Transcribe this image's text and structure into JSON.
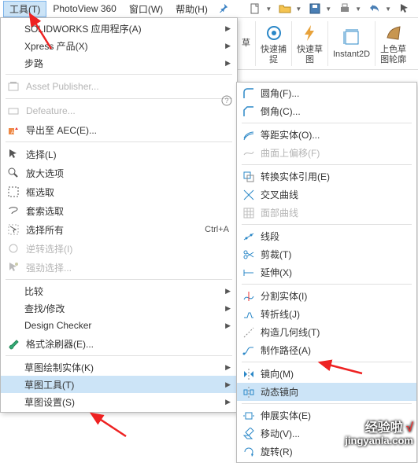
{
  "menubar": {
    "tools": "工具(T)",
    "photoview": "PhotoView 360",
    "window": "窗口(W)",
    "help": "帮助(H)"
  },
  "ribbon": {
    "grp0": "草",
    "grp1_l1": "快速捕",
    "grp1_l2": "捉",
    "grp2_l1": "快速草",
    "grp2_l2": "图",
    "grp3": "Instant2D",
    "grp4_l1": "上色草",
    "grp4_l2": "图轮廓"
  },
  "dd": {
    "sub_sw": "SOLIDWORKS 应用程序(A)",
    "sub_xpress": "Xpress 产品(X)",
    "sub_bulu": "步路",
    "asset": "Asset Publisher...",
    "defeature": "Defeature...",
    "export_aec": "导出至 AEC(E)...",
    "select": "选择(L)",
    "magnify": "放大选项",
    "boxsel": "框选取",
    "lasso": "套索选取",
    "selall": "选择所有",
    "selall_sc": "Ctrl+A",
    "invsel": "逆转选择(I)",
    "powersel": "强劲选择...",
    "compare": "比较",
    "findmod": "查找/修改",
    "design_checker": "Design Checker",
    "fmt_painter": "格式涂刷器(E)...",
    "sketch_entities": "草图绘制实体(K)",
    "sketch_tools": "草图工具(T)",
    "sketch_settings": "草图设置(S)"
  },
  "sm": {
    "fillet": "圆角(F)...",
    "chamfer": "倒角(C)...",
    "offset_ent": "等距实体(O)...",
    "surf_offset": "曲面上偏移(F)",
    "convert": "转换实体引用(E)",
    "intersect": "交叉曲线",
    "face_curve": "面部曲线",
    "segment": "线段",
    "trim": "剪裁(T)",
    "extend": "延伸(X)",
    "split": "分割实体(I)",
    "jog": "转折线(J)",
    "construct": "构造几何线(T)",
    "makepath": "制作路径(A)",
    "mirror": "镜向(M)",
    "dyn_mirror": "动态镜向",
    "stretch": "伸展实体(E)",
    "move": "移动(V)...",
    "rotate": "旋转(R)"
  },
  "watermark": {
    "l1a": "经验啦",
    "l1b": "√",
    "l2": "jingyanla.com"
  }
}
